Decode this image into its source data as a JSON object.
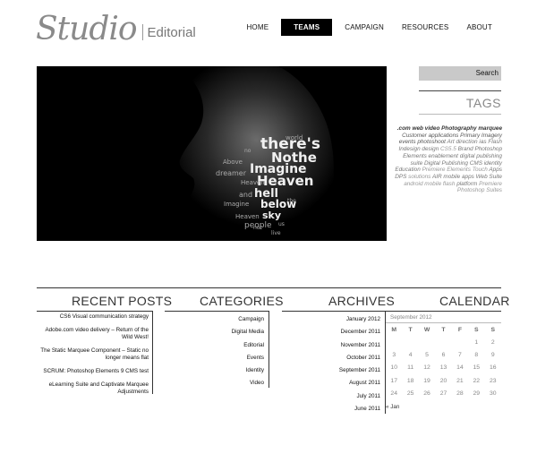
{
  "logo": {
    "script": "Studio",
    "subtitle": "Editorial"
  },
  "nav": [
    {
      "label": "HOME",
      "active": false
    },
    {
      "label": "TEAMS",
      "active": true
    },
    {
      "label": "CAMPAIGN",
      "active": false
    },
    {
      "label": "RESOURCES",
      "active": false
    },
    {
      "label": "ABOUT",
      "active": false
    }
  ],
  "hero": {
    "words": [
      "there's",
      "Nothe",
      "Imagine",
      "Heaven",
      "hell",
      "below",
      "sky",
      "people",
      "and",
      "world",
      "dreamer",
      "Above",
      "no",
      "Imagine",
      "Heaven",
      "not",
      "us",
      "live",
      "the",
      "Heaven"
    ]
  },
  "search": {
    "label": "Search"
  },
  "tags": {
    "title": "TAGS",
    "items": [
      {
        "text": ".com",
        "w": "b"
      },
      {
        "text": "web video",
        "w": "b"
      },
      {
        "text": "Photography",
        "w": "b"
      },
      {
        "text": "marquee",
        "w": "b"
      },
      {
        "text": "Customer applications",
        "w": ""
      },
      {
        "text": "Primary Imagery",
        "w": ""
      },
      {
        "text": "events",
        "w": ""
      },
      {
        "text": "photoshoot",
        "w": ""
      },
      {
        "text": "Art direction",
        "w": "m"
      },
      {
        "text": "ias",
        "w": "m"
      },
      {
        "text": "Flash",
        "w": "m"
      },
      {
        "text": "Indesign",
        "w": "m"
      },
      {
        "text": "design",
        "w": "m"
      },
      {
        "text": "CS5.5",
        "w": "l"
      },
      {
        "text": "Brand",
        "w": "m"
      },
      {
        "text": "Photoshop Elements",
        "w": "m"
      },
      {
        "text": "enablement",
        "w": "m"
      },
      {
        "text": "digital publishing suite",
        "w": "m"
      },
      {
        "text": "Digital Publishing",
        "w": "m"
      },
      {
        "text": "CMS",
        "w": "m"
      },
      {
        "text": "identity",
        "w": "m"
      },
      {
        "text": "Education",
        "w": "m"
      },
      {
        "text": "Premiere Elements",
        "w": "l"
      },
      {
        "text": "Touch",
        "w": "l"
      },
      {
        "text": "Apps",
        "w": "m"
      },
      {
        "text": "DPS",
        "w": "m"
      },
      {
        "text": "solutions",
        "w": "l"
      },
      {
        "text": "AIR",
        "w": "m"
      },
      {
        "text": "mobile apps",
        "w": "m"
      },
      {
        "text": "Web Suite",
        "w": "m"
      },
      {
        "text": "android",
        "w": "l"
      },
      {
        "text": "mobile",
        "w": "l"
      },
      {
        "text": "flash",
        "w": "l"
      },
      {
        "text": "platform",
        "w": "m"
      },
      {
        "text": "Premiere",
        "w": "l"
      },
      {
        "text": "Photoshop",
        "w": "l"
      },
      {
        "text": "Suites",
        "w": "l"
      }
    ]
  },
  "sections": {
    "recent_posts": {
      "title": "RECENT POSTS",
      "items": [
        "CS6 Visual communication strategy",
        "Adobe.com video delivery – Return of the Wild West!",
        "The Static Marquee Component – Static no longer means flat",
        "SCRUM: Photoshop Elements 9 CMS test",
        "eLearning Suite and Captivate Marquee Adjustments"
      ]
    },
    "categories": {
      "title": "CATEGORIES",
      "items": [
        "Campaign",
        "Digital Media",
        "Editorial",
        "Events",
        "Identity",
        "Video"
      ]
    },
    "archives": {
      "title": "ARCHIVES",
      "items": [
        "January 2012",
        "December 2011",
        "November 2011",
        "October 2011",
        "September 2011",
        "August 2011",
        "July 2011",
        "June 2011"
      ]
    },
    "calendar": {
      "title": "CALENDAR",
      "month": "September 2012",
      "days": [
        "M",
        "T",
        "W",
        "T",
        "F",
        "S",
        "S"
      ],
      "weeks": [
        [
          "",
          "",
          "",
          "",
          "",
          "1",
          "2"
        ],
        [
          "3",
          "4",
          "5",
          "6",
          "7",
          "8",
          "9"
        ],
        [
          "10",
          "11",
          "12",
          "13",
          "14",
          "15",
          "16"
        ],
        [
          "17",
          "18",
          "19",
          "20",
          "21",
          "22",
          "23"
        ],
        [
          "24",
          "25",
          "26",
          "27",
          "28",
          "29",
          "30"
        ]
      ],
      "prev": "« Jan"
    }
  }
}
